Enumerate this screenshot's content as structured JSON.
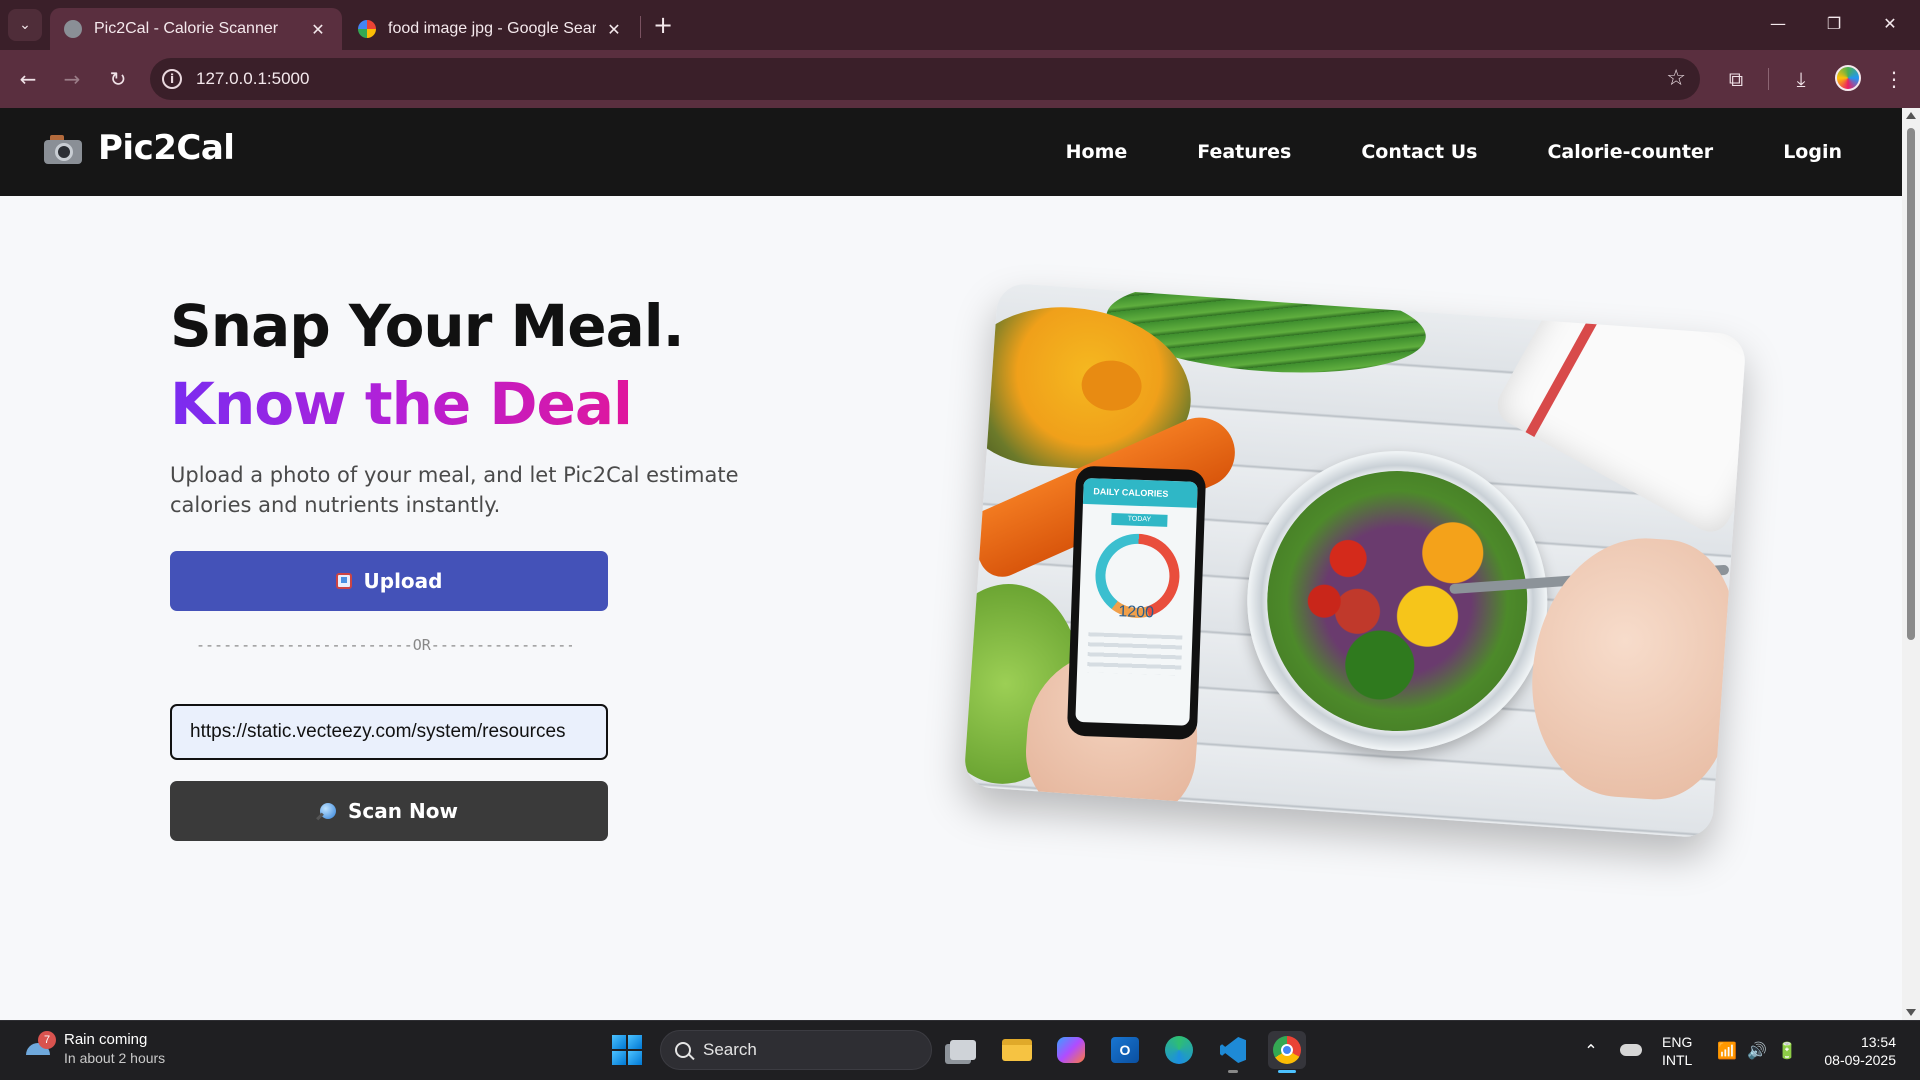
{
  "browser": {
    "tabs": [
      {
        "title": "Pic2Cal - Calorie Scanner",
        "active": true
      },
      {
        "title": "food image jpg - Google Search",
        "active": false
      }
    ],
    "url": "127.0.0.1:5000"
  },
  "site": {
    "brand": "Pic2Cal",
    "nav": [
      "Home",
      "Features",
      "Contact Us",
      "Calorie-counter",
      "Login"
    ]
  },
  "hero": {
    "headline_1": "Snap Your Meal.",
    "headline_2": "Know the Deal",
    "subtitle": "Upload a photo of your meal, and let Pic2Cal estimate calories and nutrients instantly.",
    "upload_label": "Upload",
    "or_divider": "------------------------OR--------------------------",
    "url_value": "https://static.vecteezy.com/system/resources",
    "scan_label": "Scan Now",
    "phone_header": "DAILY CALORIES",
    "phone_today": "TODAY",
    "phone_value": "1200"
  },
  "taskbar": {
    "weather_title": "Rain coming",
    "weather_sub": "In about 2 hours",
    "weather_badge": "7",
    "search_placeholder": "Search",
    "lang_line1": "ENG",
    "lang_line2": "INTL",
    "time": "13:54",
    "date": "08-09-2025"
  },
  "colors": {
    "browser_frame": "#3a1f29",
    "browser_toolbar": "#5a2f3f",
    "site_nav": "#161616",
    "upload_button": "#4452b8",
    "scan_button": "#3a3a3a",
    "gradient_start": "#7a2cf0",
    "gradient_end": "#e0169c"
  }
}
